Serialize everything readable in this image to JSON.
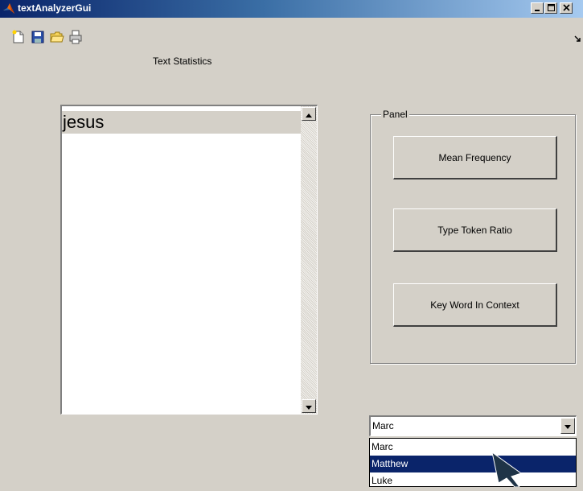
{
  "window": {
    "title": "textAnalyzerGui",
    "controls": [
      "minimize-icon",
      "maximize-icon",
      "close-icon"
    ]
  },
  "toolbar": {
    "icons": [
      "new-file-icon",
      "save-icon",
      "open-folder-icon",
      "print-icon"
    ]
  },
  "main": {
    "title": "Text Statistics",
    "listbox": {
      "items": [
        "jesus"
      ],
      "selected_index": 0
    }
  },
  "panel": {
    "title": "Panel",
    "buttons": [
      {
        "label": "Mean Frequency"
      },
      {
        "label": "Type Token Ratio"
      },
      {
        "label": "Key Word In Context"
      }
    ]
  },
  "dropdown": {
    "value": "Marc",
    "options": [
      "Marc",
      "Matthew",
      "Luke"
    ],
    "highlighted_index": 1
  },
  "colors": {
    "window_bg": "#d4d0c8",
    "titlebar_start": "#0a246a",
    "selection": "#0a246a"
  }
}
